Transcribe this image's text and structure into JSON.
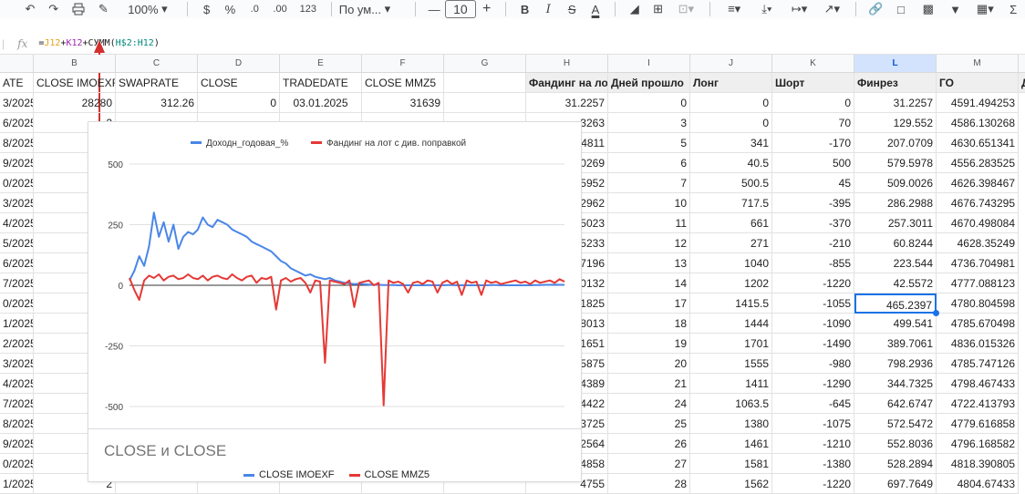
{
  "toolbar": {
    "zoom": "100%",
    "currency": "$",
    "percent": "%",
    "dec_less": ".0",
    "dec_more": ".00",
    "number_format": "123",
    "font": "По ум...",
    "font_size": "10",
    "minus": "—",
    "plus": "+",
    "bold": "B",
    "italic": "I",
    "strike": "S",
    "text_color": "A"
  },
  "formula_bar": {
    "fx": "fx",
    "formula_parts": [
      "=",
      "J12",
      "+",
      "K12",
      "+СУММ(",
      "H$2:H12",
      ")"
    ]
  },
  "columns": [
    {
      "letter": "",
      "w": 37
    },
    {
      "letter": "B",
      "w": 90
    },
    {
      "letter": "C",
      "w": 90
    },
    {
      "letter": "D",
      "w": 90
    },
    {
      "letter": "E",
      "w": 90
    },
    {
      "letter": "F",
      "w": 90
    },
    {
      "letter": "G",
      "w": 90
    },
    {
      "letter": "H",
      "w": 90
    },
    {
      "letter": "I",
      "w": 90
    },
    {
      "letter": "J",
      "w": 90
    },
    {
      "letter": "K",
      "w": 90
    },
    {
      "letter": "L",
      "w": 90
    },
    {
      "letter": "M",
      "w": 90
    },
    {
      "letter": "",
      "w": 17
    }
  ],
  "header_row": [
    "ATE",
    "CLOSE IMOEXF",
    "SWAPRATE",
    "CLOSE",
    "TRADEDATE",
    "CLOSE MMZ5",
    "",
    "Фандинг на лот",
    "Дней прошло",
    "Лонг",
    "Шорт",
    "Финрез",
    "ГО",
    "Д"
  ],
  "rows": [
    [
      "3/2025",
      "28280",
      "312.26",
      "0",
      "03.01.2025",
      "31639",
      "",
      "31.2257",
      "0",
      "0",
      "0",
      "31.2257",
      "4591.494253"
    ],
    [
      "6/2025",
      "2",
      "",
      "",
      "",
      "",
      "",
      "3263",
      "3",
      "0",
      "70",
      "129.552",
      "4586.130268"
    ],
    [
      "8/2025",
      "2",
      "",
      "",
      "",
      "",
      "",
      "4811",
      "5",
      "341",
      "-170",
      "207.0709",
      "4630.651341"
    ],
    [
      "9/2025",
      "2",
      "",
      "",
      "",
      "",
      "",
      "0269",
      "6",
      "40.5",
      "500",
      "579.5978",
      "4556.283525"
    ],
    [
      "0/2025",
      "2",
      "",
      "",
      "",
      "",
      "",
      "5952",
      "7",
      "500.5",
      "45",
      "509.0026",
      "4626.398467"
    ],
    [
      "3/2025",
      "2",
      "",
      "",
      "",
      "",
      "",
      "2962",
      "10",
      "717.5",
      "-395",
      "286.2988",
      "4676.743295"
    ],
    [
      "4/2025",
      "2",
      "",
      "",
      "",
      "",
      "",
      "5023",
      "11",
      "661",
      "-370",
      "257.3011",
      "4670.498084"
    ],
    [
      "5/2025",
      "2",
      "",
      "",
      "",
      "",
      "",
      "5233",
      "12",
      "271",
      "-210",
      "60.8244",
      "4628.35249"
    ],
    [
      "6/2025",
      "2",
      "",
      "",
      "",
      "",
      "",
      "7196",
      "13",
      "1040",
      "-855",
      "223.544",
      "4736.704981"
    ],
    [
      "7/2025",
      "2",
      "",
      "",
      "",
      "",
      "",
      "0132",
      "14",
      "1202",
      "-1220",
      "42.5572",
      "4777.088123"
    ],
    [
      "0/2025",
      "2",
      "",
      "",
      "",
      "",
      "",
      "1825",
      "17",
      "1415.5",
      "-1055",
      "465.2397",
      "4780.804598"
    ],
    [
      "1/2025",
      "2",
      "",
      "",
      "",
      "",
      "",
      "8013",
      "18",
      "1444",
      "-1090",
      "499.541",
      "4785.670498"
    ],
    [
      "2/2025",
      "2",
      "",
      "",
      "",
      "",
      "",
      "1651",
      "19",
      "1701",
      "-1490",
      "389.7061",
      "4836.015326"
    ],
    [
      "3/2025",
      "2",
      "",
      "",
      "",
      "",
      "",
      "5875",
      "20",
      "1555",
      "-980",
      "798.2936",
      "4785.747126"
    ],
    [
      "4/2025",
      "2",
      "",
      "",
      "",
      "",
      "",
      "4389",
      "21",
      "1411",
      "-1290",
      "344.7325",
      "4798.467433"
    ],
    [
      "7/2025",
      "2",
      "",
      "",
      "",
      "",
      "",
      "4422",
      "24",
      "1063.5",
      "-645",
      "642.6747",
      "4722.413793"
    ],
    [
      "8/2025",
      "2",
      "",
      "",
      "",
      "",
      "",
      "3725",
      "25",
      "1380",
      "-1075",
      "572.5472",
      "4779.616858"
    ],
    [
      "9/2025",
      "2",
      "",
      "",
      "",
      "",
      "",
      "2564",
      "26",
      "1461",
      "-1210",
      "552.8036",
      "4796.168582"
    ],
    [
      "0/2025",
      "2",
      "",
      "",
      "",
      "",
      "",
      "4858",
      "27",
      "1581",
      "-1380",
      "528.2894",
      "4818.390805"
    ],
    [
      "1/2025",
      "2",
      "",
      "",
      "",
      "",
      "",
      "4755",
      "28",
      "1562",
      "-1220",
      "697.7649",
      "4804.67433"
    ]
  ],
  "chart1": {
    "legend": [
      {
        "name": "Доходн_годовая_%",
        "color": "#4a86e8"
      },
      {
        "name": "Фандинг на лот с див. поправкой",
        "color": "#e53935"
      }
    ],
    "y_ticks": [
      "500",
      "250",
      "0",
      "-250",
      "-500"
    ]
  },
  "chart2": {
    "title": "CLOSE и CLOSE",
    "legend": [
      {
        "name": "CLOSE IMOEXF",
        "color": "#4a86e8"
      },
      {
        "name": "CLOSE MMZ5",
        "color": "#e53935"
      }
    ]
  },
  "chart_data": [
    {
      "type": "line",
      "title": "",
      "ylim": [
        -500,
        500
      ],
      "y_ticks": [
        500,
        250,
        0,
        -250,
        -500
      ],
      "series": [
        {
          "name": "Доходн_годовая_%",
          "color": "#4a86e8",
          "values": [
            20,
            60,
            120,
            80,
            160,
            300,
            200,
            260,
            180,
            250,
            150,
            200,
            220,
            210,
            230,
            280,
            250,
            240,
            270,
            260,
            250,
            230,
            220,
            210,
            200,
            180,
            170,
            160,
            150,
            140,
            120,
            100,
            90,
            70,
            60,
            50,
            40,
            45,
            35,
            30,
            25,
            30,
            20,
            15,
            10,
            8,
            5,
            6,
            4,
            3,
            2,
            2,
            1,
            1,
            1,
            0,
            0,
            0,
            0,
            0,
            0,
            1,
            0,
            0,
            0,
            1,
            1,
            0,
            0,
            0,
            0,
            0,
            0,
            0,
            1,
            1,
            0,
            0,
            0,
            0,
            0,
            0,
            0,
            1,
            1,
            2,
            2,
            3,
            2,
            2
          ]
        },
        {
          "name": "Фандинг на лот с див. поправкой",
          "color": "#e53935",
          "values": [
            30,
            -20,
            -60,
            20,
            40,
            30,
            45,
            20,
            35,
            40,
            25,
            30,
            45,
            30,
            25,
            40,
            20,
            35,
            40,
            30,
            25,
            45,
            30,
            20,
            35,
            40,
            10,
            30,
            25,
            35,
            -100,
            20,
            30,
            15,
            25,
            30,
            10,
            -30,
            20,
            15,
            -320,
            20,
            15,
            10,
            5,
            20,
            -90,
            10,
            15,
            20,
            0,
            10,
            -495,
            20,
            10,
            15,
            5,
            -30,
            10,
            15,
            5,
            20,
            15,
            -30,
            10,
            20,
            5,
            15,
            -40,
            20,
            10,
            15,
            -40,
            20,
            10,
            15,
            5,
            10,
            15,
            20,
            10,
            15,
            5,
            20,
            10,
            15,
            20,
            10,
            25,
            15
          ]
        }
      ]
    },
    {
      "type": "line",
      "title": "CLOSE и CLOSE",
      "series": [
        {
          "name": "CLOSE IMOEXF",
          "color": "#4a86e8",
          "values": []
        },
        {
          "name": "CLOSE MMZ5",
          "color": "#e53935",
          "values": []
        }
      ]
    }
  ]
}
